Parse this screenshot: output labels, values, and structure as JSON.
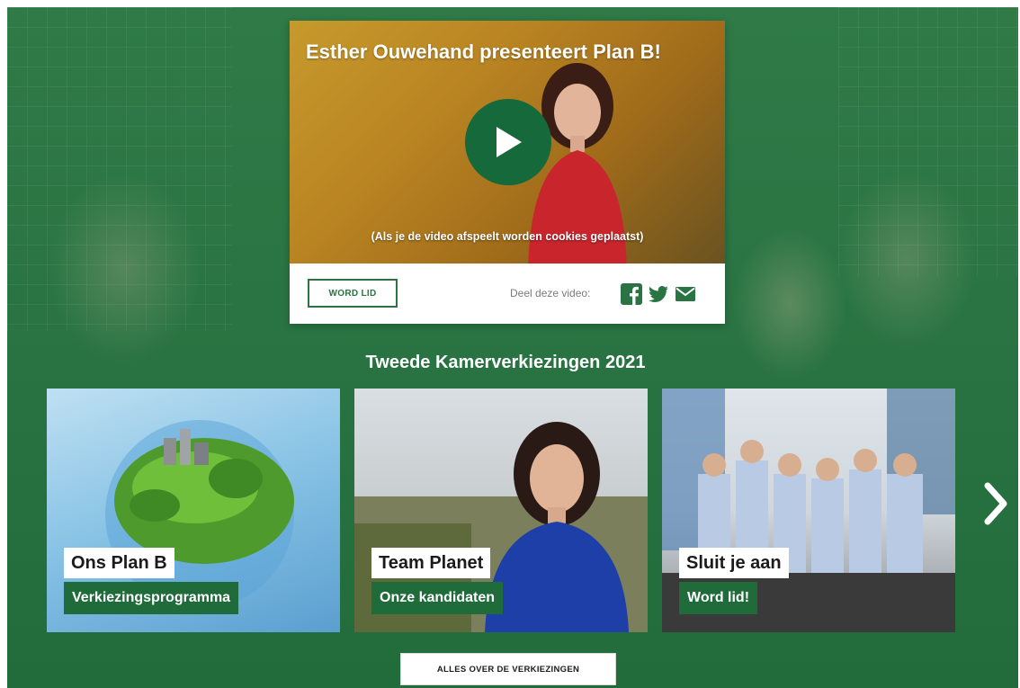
{
  "video": {
    "title": "Esther Ouwehand presenteert Plan B!",
    "cookie_note": "(Als je de video afspeelt worden cookies geplaatst)",
    "join_button": "WORD LID",
    "share_label": "Deel deze video:",
    "share_icons": [
      "facebook-icon",
      "twitter-icon",
      "email-icon"
    ]
  },
  "section": {
    "heading": "Tweede Kamerverkiezingen 2021"
  },
  "tiles": [
    {
      "title": "Ons Plan B",
      "subtitle": "Verkiezingsprogramma"
    },
    {
      "title": "Team Planet",
      "subtitle": "Onze kandidaten"
    },
    {
      "title": "Sluit je aan",
      "subtitle": "Word lid!"
    }
  ],
  "cta": {
    "label": "ALLES OVER DE VERKIEZINGEN"
  },
  "colors": {
    "brand_green": "#1f6b3a",
    "hero_green": "#2a7443",
    "white": "#ffffff"
  }
}
